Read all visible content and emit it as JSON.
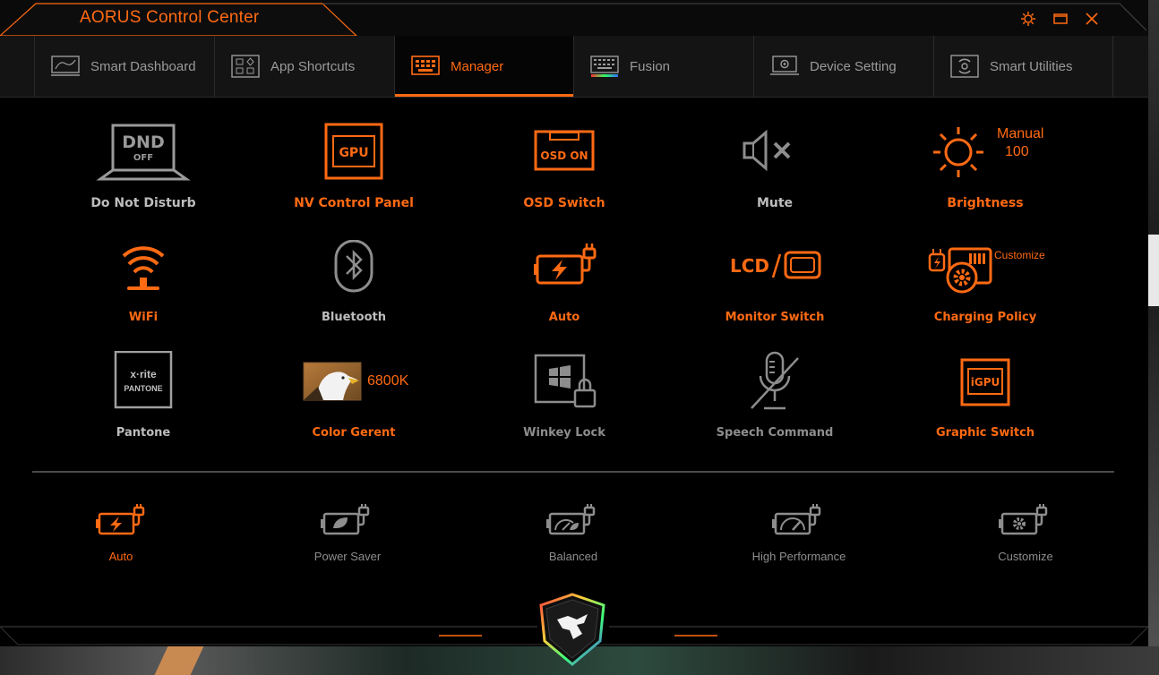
{
  "app": {
    "title": "AORUS Control Center"
  },
  "tabs": [
    {
      "label": "Smart Dashboard"
    },
    {
      "label": "App Shortcuts"
    },
    {
      "label": "Manager"
    },
    {
      "label": "Fusion"
    },
    {
      "label": "Device Setting"
    },
    {
      "label": "Smart Utilities"
    }
  ],
  "tiles": {
    "dnd": {
      "label": "Do Not Disturb",
      "icon_text_top": "DND",
      "icon_text_bottom": "OFF"
    },
    "nv": {
      "label": "NV Control Panel",
      "icon_text": "GPU"
    },
    "osd": {
      "label": "OSD Switch",
      "icon_text": "OSD ON"
    },
    "mute": {
      "label": "Mute"
    },
    "brightness": {
      "label": "Brightness",
      "mode": "Manual",
      "value": "100"
    },
    "wifi": {
      "label": "WiFi"
    },
    "bluetooth": {
      "label": "Bluetooth"
    },
    "auto": {
      "label": "Auto"
    },
    "monitor": {
      "label": "Monitor Switch",
      "icon_text": "LCD"
    },
    "charging": {
      "label": "Charging Policy",
      "badge": "Customize"
    },
    "pantone": {
      "label": "Pantone",
      "logo_top": "x·rite",
      "logo_bottom": "PANTONE"
    },
    "color": {
      "label": "Color Gerent",
      "value": "6800K"
    },
    "winkey": {
      "label": "Winkey Lock"
    },
    "speech": {
      "label": "Speech Command"
    },
    "graphic": {
      "label": "Graphic Switch",
      "icon_text": "iGPU"
    }
  },
  "power_modes": [
    {
      "label": "Auto"
    },
    {
      "label": "Power Saver"
    },
    {
      "label": "Balanced"
    },
    {
      "label": "High Performance"
    },
    {
      "label": "Customize"
    }
  ],
  "colors": {
    "accent": "#ff6a13",
    "inactive": "#8d8d8d",
    "background": "#000000"
  },
  "icons": [
    "settings-gear-icon",
    "maximize-icon",
    "close-icon",
    "aorus-eagle-logo-icon"
  ]
}
